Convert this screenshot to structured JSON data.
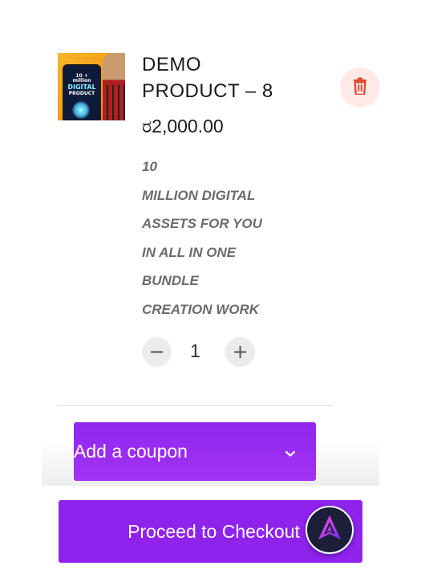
{
  "product": {
    "title_line1": "DEMO",
    "title_line2": "PRODUCT – 8",
    "price": "ರ2,000.00",
    "description_lines": [
      "10",
      "MILLION DIGITAL",
      "ASSETS FOR YOU",
      "IN ALL IN ONE",
      "BUNDLE",
      "CREATION WORK"
    ],
    "image": {
      "line1": "10 + million",
      "line2": "DIGITAL",
      "line3": "PRODUCT"
    },
    "quantity": "1"
  },
  "controls": {
    "minus_symbol": "−",
    "plus_symbol": "+"
  },
  "coupon": {
    "label": "Add a coupon"
  },
  "checkout": {
    "label": "Proceed to Checkout"
  },
  "icons": {
    "delete": "trash-icon",
    "coupon_toggle": "chevron-down-icon",
    "fab": "rocket-logo-icon"
  },
  "colors": {
    "accent": "#9022ee",
    "delete_icon": "#e0452f",
    "delete_bg": "#fdeae6",
    "description_text": "#6b6b6b"
  }
}
